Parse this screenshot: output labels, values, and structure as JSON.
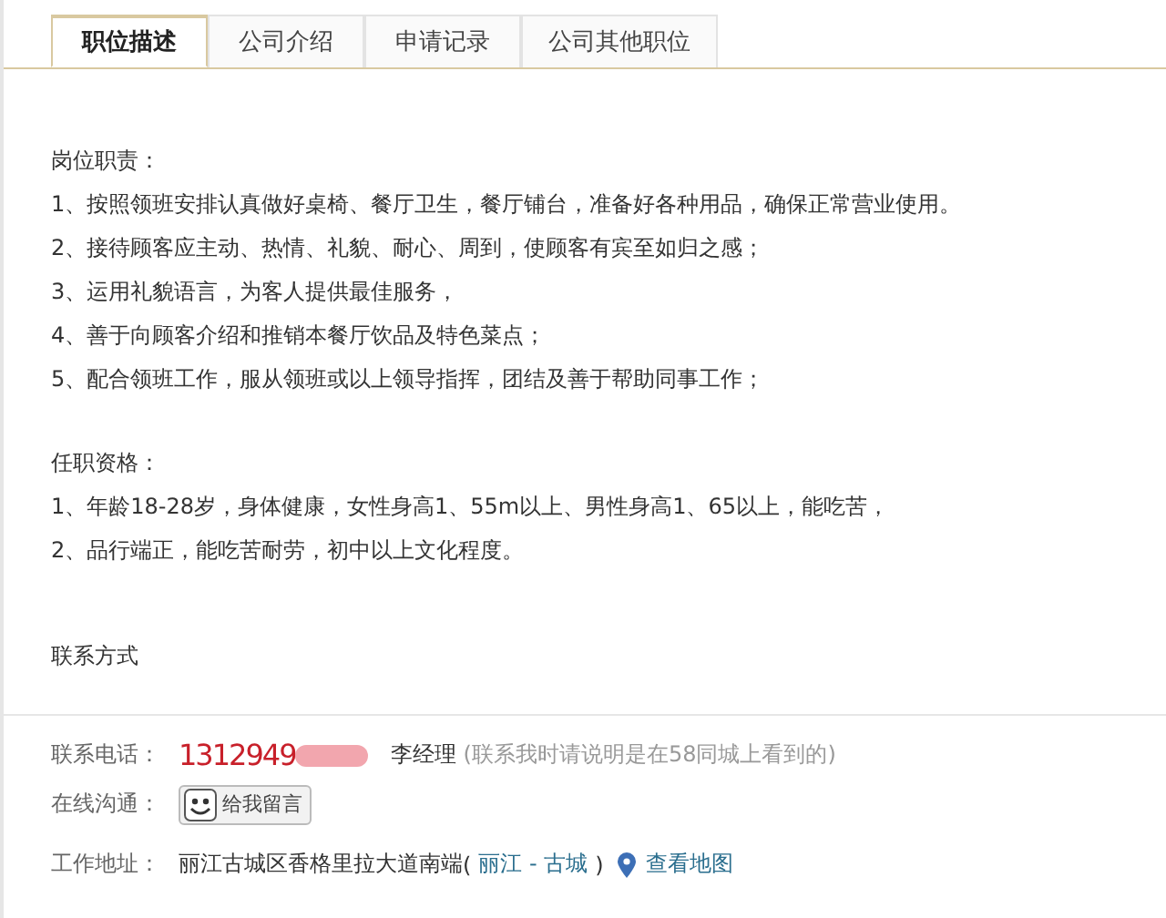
{
  "tabs": [
    {
      "label": "职位描述",
      "selected": true
    },
    {
      "label": "公司介绍",
      "selected": false
    },
    {
      "label": "申请记录",
      "selected": false
    },
    {
      "label": "公司其他职位",
      "selected": false
    }
  ],
  "sections": [
    {
      "heading": "岗位职责：",
      "items": [
        "1、按照领班安排认真做好桌椅、餐厅卫生，餐厅铺台，准备好各种用品，确保正常营业使用。",
        "2、接待顾客应主动、热情、礼貌、耐心、周到，使顾客有宾至如归之感；",
        "3、运用礼貌语言，为客人提供最佳服务，",
        "4、善于向顾客介绍和推销本餐厅饮品及特色菜点；",
        "5、配合领班工作，服从领班或以上领导指挥，团结及善于帮助同事工作；"
      ]
    },
    {
      "heading": "任职资格：",
      "items": [
        "1、年龄18-28岁，身体健康，女性身高1、55m以上、男性身高1、65以上，能吃苦，",
        "2、品行端正，能吃苦耐劳，初中以上文化程度。"
      ]
    }
  ],
  "contact": {
    "title": "联系方式",
    "phone_label": "联系电话：",
    "phone": "1312949",
    "contact_name": "李经理",
    "note": "(联系我时请说明是在58同城上看到的)",
    "chat_label": "在线沟通：",
    "chat_button": "给我留言",
    "address_label": "工作地址：",
    "address": "丽江古城区香格里拉大道南端",
    "area_open": "(",
    "area": "丽江 - 古城",
    "area_close": ")",
    "map_link": "查看地图"
  }
}
